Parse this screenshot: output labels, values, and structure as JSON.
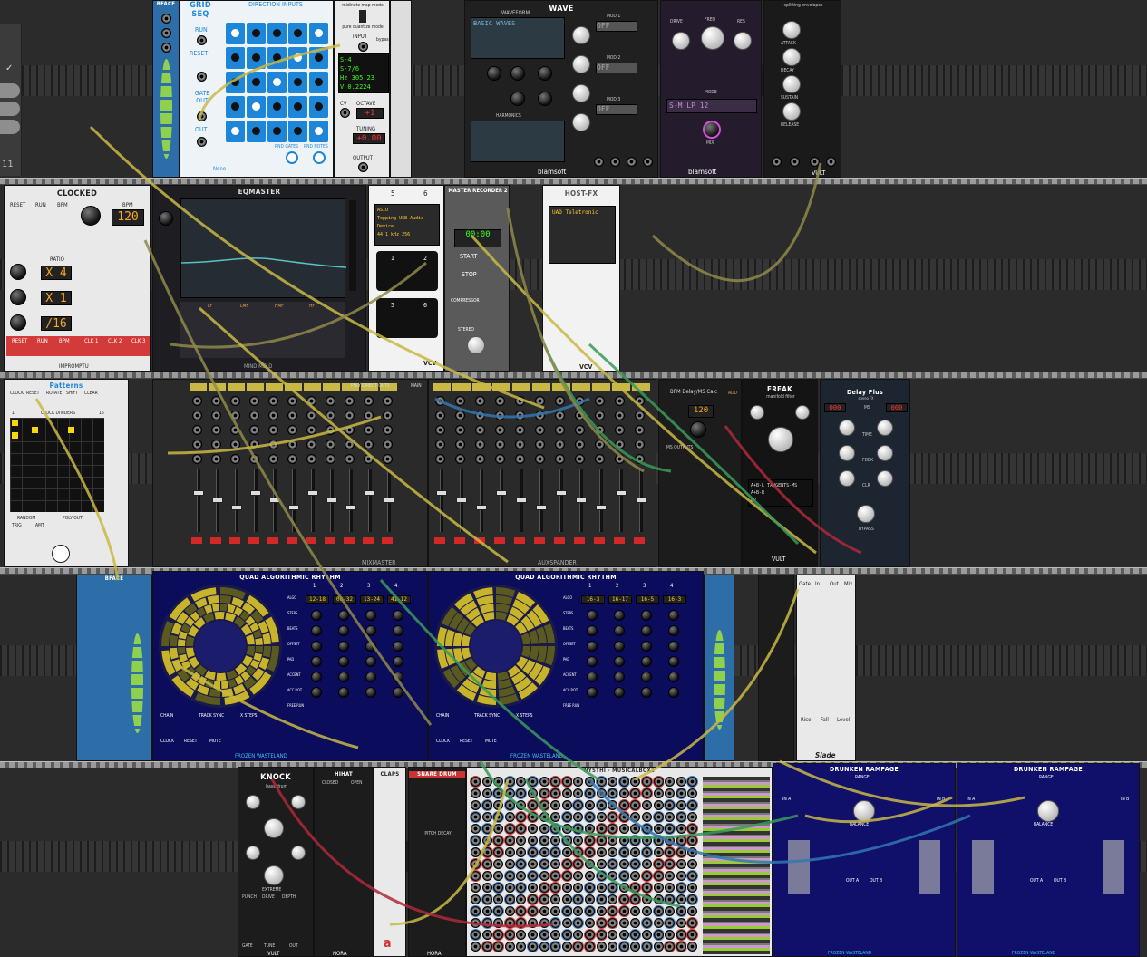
{
  "sidebar": {
    "check_mark": "✓",
    "counter": "11"
  },
  "modules": {
    "grid_seq": {
      "title": "GRID SEQ",
      "run": "RUN",
      "reset": "RESET",
      "gate_out": "GATE OUT",
      "out": "OUT",
      "direction": "DIRECTION INPUTS",
      "bottom_labels": [
        "RND GATES",
        "RND NOTES"
      ],
      "none": "None"
    },
    "midi_map": {
      "title": "midinote map mode",
      "sub": "pure quantize mode",
      "input": "INPUT",
      "bypass": "bypass",
      "readout": [
        "S-4",
        "S-7/6",
        "Hz 305.23",
        "V 0.2224"
      ],
      "octave": "OCTAVE",
      "tuning": "TUNING",
      "tuning_value": "+0.00",
      "cv": "CV",
      "output": "OUTPUT"
    },
    "wave": {
      "title": "WAVE",
      "brand": "blamsoft",
      "waveform": "WAVEFORM",
      "screen": "BASIC WAVES",
      "labels": [
        "POS",
        "NOISE",
        "DENSITY",
        "DETUNE",
        "SPREAD",
        "HARMONICS",
        "OCTAVE",
        "SEMI",
        "FINE",
        "LEVEL",
        "MOD 1",
        "MOD 2",
        "MOD 3",
        "POST"
      ],
      "off": "OFF",
      "bottom": [
        "FM",
        "V/OCT",
        "IN",
        "OUT"
      ]
    },
    "filter": {
      "brand": "blamsoft",
      "labels": [
        "DRIVE",
        "FREQ",
        "RES",
        "MODE",
        "MIX"
      ],
      "mode_display": "S-M LP 12"
    },
    "vult_env": {
      "title": "splitting envelopes",
      "labels": [
        "ATTACK",
        "DECAY",
        "SUSTAIN",
        "RELEASE",
        "GATE",
        "OUT"
      ],
      "brand": "VULT"
    },
    "clocked": {
      "title": "CLOCKED",
      "brand": "IMPROMPTU",
      "bpm": "BPM",
      "bpm_value": "120",
      "labels": [
        "RESET",
        "RUN",
        "BPM",
        "RESET",
        "RUN",
        "MODE",
        "SWING",
        "PW",
        "CLK",
        "RATIO",
        "SWING 1",
        "PW 1",
        "DELAY 1",
        "SWING 2",
        "PW 2",
        "DELAY 2",
        "SWING 3",
        "PW 3",
        "DELAY 3",
        "RESET",
        "RUN",
        "BPM",
        "CLK 1",
        "CLK 2",
        "CLK 3"
      ],
      "ratios": [
        "X 4",
        "X 1",
        "/16"
      ]
    },
    "eqmaster": {
      "title": "EQMASTER",
      "brand": "MIND MELD",
      "bands": [
        "LF",
        "LMF",
        "HMF",
        "HF"
      ],
      "labels": [
        "ANALYSIS",
        "BANDS",
        "SHOW",
        "OUT",
        "GAIN",
        "TRACK",
        "ACTIVE",
        "BYPASS"
      ],
      "freq": "Freq (Hz)",
      "gain": "Gain (dB)"
    },
    "audio": {
      "title_a": "5",
      "title_b": "6",
      "screen_lines": [
        "ASIO",
        "Topping USB Audio Device",
        "44.1 kHz   256"
      ],
      "ports": [
        "1",
        "2",
        "5",
        "6"
      ],
      "brand": "VCV"
    },
    "recorder": {
      "title": "MASTER RECORDER 2",
      "time": "00:00",
      "labels": [
        "START",
        "STOP",
        "COMPRESSOR",
        "STEREO"
      ],
      "brand": "MIND MELD"
    },
    "hostfx": {
      "title": "HOST-FX",
      "plugin": "UAD Teletronic",
      "brand": "VCV",
      "bottom": [
        "LEFT",
        "RIGHT"
      ]
    },
    "patterns": {
      "title": "Patterns",
      "labels": [
        "CLOCK",
        "RESET",
        "ROTATE",
        "SHIFT",
        "CLEAR",
        "OR",
        "XOR",
        "CLOCK DIVIDERS",
        "RANDOM",
        "TRIG",
        "AMT",
        "POLY OUT",
        "OR",
        "XOR"
      ],
      "numbers": [
        "1",
        "16"
      ]
    },
    "mixmaster": {
      "title": "MIXMASTER",
      "brand": "MIND MELD",
      "channels": [
        "Kick",
        "hat",
        "Clap",
        "SNARE",
        "PERC1",
        "PERC2",
        "PERC3",
        "synt"
      ],
      "groups": [
        "MASTER"
      ],
      "poly": "POLY DIRECT OUTS",
      "main": "MAIN"
    },
    "auxspander": {
      "title": "AUXSPANDER",
      "aux": [
        "AUXA",
        "AUXB",
        "AUXC",
        "AUXD"
      ],
      "channels": [
        "Kick",
        "hat",
        "Clap",
        "SNARE",
        "GRP1",
        "PERC1",
        "PERC2",
        "PERC3",
        "synt",
        "GRP2"
      ],
      "poly": "POLY AUX CV"
    },
    "bpm_calc": {
      "title": "BPM Delay/MS Calc",
      "bpm_value": "120",
      "ms": "MS OUTPUTS",
      "brand": "ADD"
    },
    "freak": {
      "title": "FREAK",
      "sub": "manifold filter",
      "screen": [
        "A+B-L TANGENTS-MS",
        "A+B-R",
        "BP"
      ],
      "brand": "VULT"
    },
    "delay_plus": {
      "title": "Delay Plus",
      "sub": "stereo FX",
      "ms": "MS",
      "value": "000",
      "labels": [
        "TIME",
        "FDBK",
        "CLR",
        "WET",
        "MIX",
        "BYPASS"
      ]
    },
    "bface": {
      "title": "BFACE",
      "bottom": "Frozen Wasteland"
    },
    "qar_left": {
      "title": "QUAD ALGORITHMIC RHYTHM",
      "track_labels": [
        "1",
        "2",
        "3",
        "4"
      ],
      "row_labels": [
        "ALGO",
        "STEPS",
        "BEATS",
        "OFFSET",
        "PAD",
        "ACCENT",
        "ACC.ROT",
        "FREE RUN",
        "START",
        "EOC",
        "ACCENT",
        "BEAT"
      ],
      "values": [
        "12-18",
        "08-32",
        "13-24",
        "41-12"
      ],
      "chain": "CHAIN",
      "trackchain": "TRACK SYNC",
      "xsteps": "X STEPS",
      "modes": [
        "NONE",
        "BOSS",
        "EMPLOYEE"
      ],
      "clock": "CLOCK",
      "reset": "RESET",
      "mute": "MUTE",
      "brand": "FROZEN WASTELAND"
    },
    "qar_right": {
      "title": "QUAD ALGORITHMIC RHYTHM",
      "track_labels": [
        "1",
        "2",
        "3",
        "4"
      ],
      "values": [
        "16-3",
        "16-17",
        "16-5",
        "16-3"
      ],
      "chain": "CHAIN",
      "trackchain": "TRACK SYNC",
      "xsteps": "X STEPS",
      "clock": "CLOCK",
      "reset": "RESET",
      "mute": "MUTE",
      "brand": "FROZEN WASTELAND"
    },
    "slade": {
      "title": "Slade",
      "labels": [
        "Gate",
        "In",
        "Out",
        "Mix",
        "Rise",
        "Fall",
        "Level"
      ]
    },
    "knock": {
      "title": "KNOCK",
      "sub": "bass drum",
      "labels": [
        "PITCH",
        "TONE",
        "DECAY",
        "FM",
        "SHAPE",
        "EXTREME",
        "PUNCH",
        "DRIVE",
        "DEPTH",
        "GATE",
        "TUNE",
        "OUT"
      ],
      "brand": "VULT"
    },
    "hihat": {
      "title": "HIHAT",
      "labels": [
        "CLOSED",
        "OPEN",
        "DECAY",
        "LEVEL",
        "TRIG",
        "TONE",
        "RES",
        "METAL",
        "ACCENT",
        "NOISE",
        "HHAT"
      ],
      "brand": "HORA"
    },
    "claps": {
      "title": "CLAPS",
      "brand": "a"
    },
    "snare": {
      "title": "SNARE DRUM",
      "labels": [
        "TONE",
        "PITCH FM",
        "PITCH DECAY",
        "LEVEL",
        "MOD",
        "HP",
        "ACCENT",
        "TRIG",
        "OUT"
      ],
      "brand": "HORA"
    },
    "musicalbox": {
      "title": "NYSTHI - MUSICALBOX2"
    },
    "drunken_l": {
      "title": "DRUNKEN RAMPAGE",
      "labels": [
        "IN A",
        "IN B",
        "TRIG",
        "RANGE",
        "BALANCE",
        "OUT A",
        "OUT B",
        "RISE",
        "FALL",
        "CYCLE",
        "RISING",
        "FALLING",
        "EOC"
      ],
      "brand": "FROZEN WASTELAND"
    },
    "drunken_r": {
      "title": "DRUNKEN RAMPAGE",
      "labels": [
        "IN A",
        "IN B",
        "TRIG",
        "RANGE",
        "BALANCE",
        "OUT A",
        "OUT B",
        "RISE",
        "FALL",
        "CYCLE",
        "RISING",
        "FALLING",
        "EOC"
      ],
      "brand": "FROZEN WASTELAND"
    }
  },
  "colors": {
    "rack": "#3a3a3a",
    "rail": "#9a9a9a",
    "cable_yellow": "#c9b844",
    "cable_green": "#3a9a5a",
    "cable_red": "#b0283a",
    "cable_blue": "#3377b0",
    "cable_olive": "#8f8a4a",
    "grid_blue": "#1e86d8",
    "qar_yellow": "#c8b42a",
    "navy": "#0c0c5c"
  }
}
